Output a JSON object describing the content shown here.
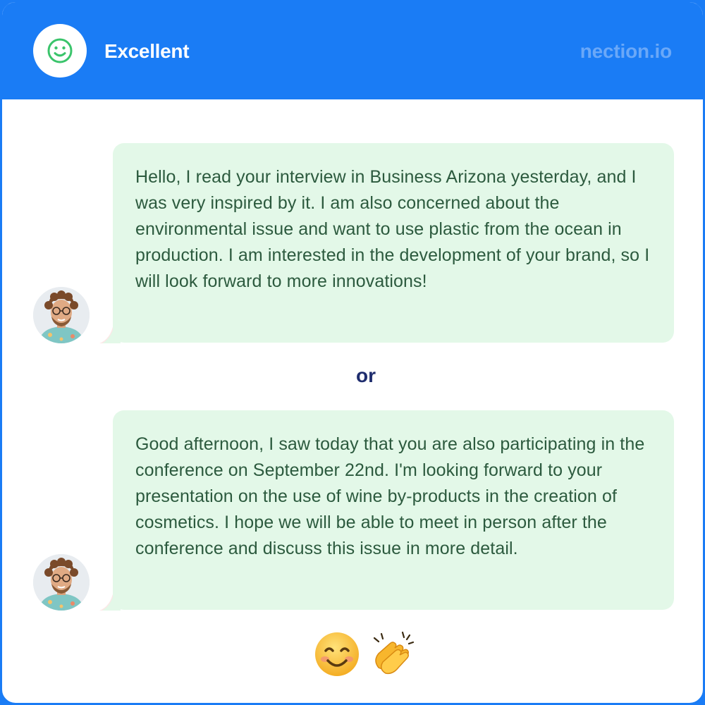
{
  "header": {
    "rating_icon": "smiley-face-icon",
    "rating_label": "Excellent",
    "brand": "nection.io",
    "colors": {
      "background": "#1a7cf5",
      "brand_text": "#6aa8f8",
      "rating_icon": "#3ac46b"
    }
  },
  "messages": [
    {
      "avatar_icon": "user-avatar",
      "text": "Hello, I read your interview in Business Arizona yesterday, and I was very inspired by it. I am also concerned about the environmental issue and want to use plastic from the ocean in production. I am interested in the development of your brand, so I will look forward to more innovations!"
    },
    {
      "avatar_icon": "user-avatar",
      "text": "Good afternoon, I saw today that you are also participating in the conference on September 22nd. I'm looking forward to your presentation on the use of wine by-products in the creation of cosmetics. I hope we will be able to meet in person after the conference and discuss this issue in more detail."
    }
  ],
  "separator": "or",
  "reactions": [
    {
      "icon": "smiling-face-emoji"
    },
    {
      "icon": "clapping-hands-emoji"
    }
  ],
  "colors": {
    "bubble": "#e3f8e8",
    "bubble_text": "#2c5a3e",
    "separator_text": "#1f2d6e"
  }
}
